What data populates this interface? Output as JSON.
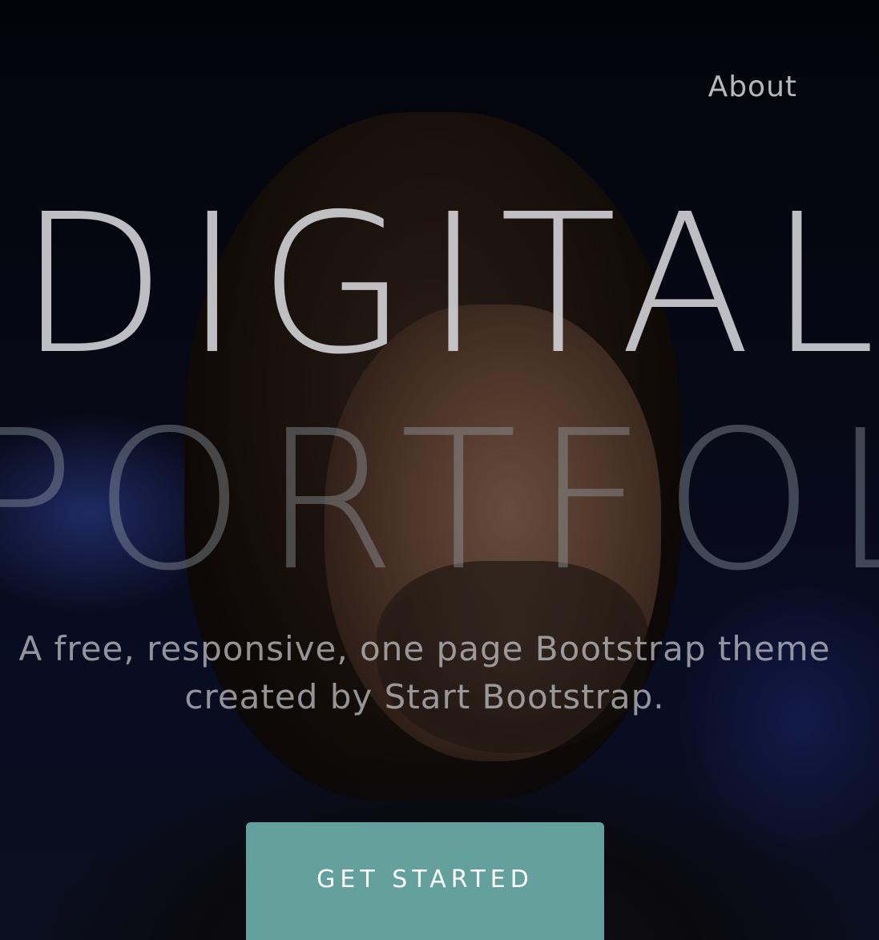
{
  "nav": {
    "about_label": "About"
  },
  "hero": {
    "title_line_1": "DIGITAL",
    "title_line_2": "PORTFOLIO",
    "subtitle_line_1": "A free, responsive, one page Bootstrap theme",
    "subtitle_line_2": "created by Start Bootstrap.",
    "cta_label": "GET STARTED"
  },
  "colors": {
    "accent": "#64a19d",
    "background": "#0a0c1c"
  }
}
